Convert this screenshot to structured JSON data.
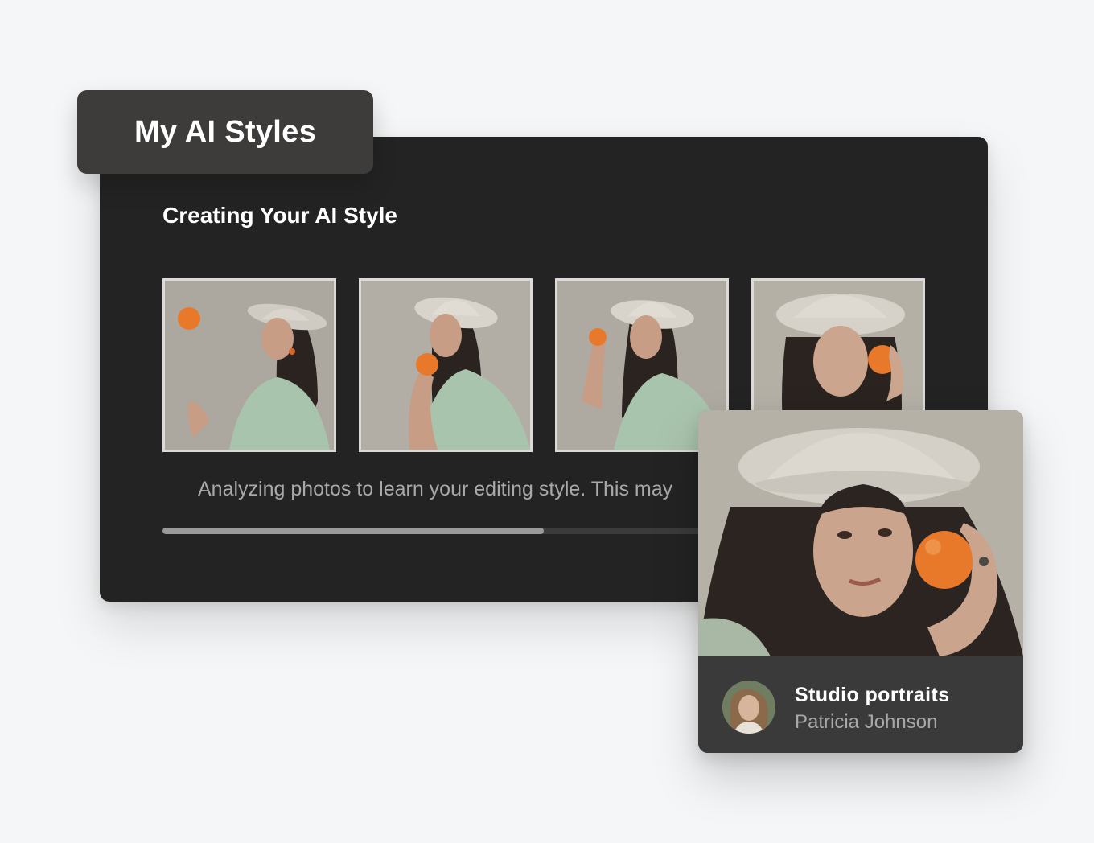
{
  "tab": {
    "label": "My AI Styles"
  },
  "panel": {
    "title": "Creating Your AI Style",
    "status_text": "Analyzing photos to learn your editing style. This may",
    "progress_percent": 51
  },
  "thumbnails": [
    {
      "name": "portrait-photo-1"
    },
    {
      "name": "portrait-photo-2"
    },
    {
      "name": "portrait-photo-3"
    },
    {
      "name": "portrait-photo-4"
    }
  ],
  "card": {
    "title": "Studio portraits",
    "author": "Patricia Johnson"
  },
  "colors": {
    "background": "#f5f6f7",
    "panel": "#232324",
    "tab": "#3d3c3b",
    "card_footer": "#3a3a3a",
    "orange": "#e8792b",
    "shirt": "#a9c4ad"
  }
}
